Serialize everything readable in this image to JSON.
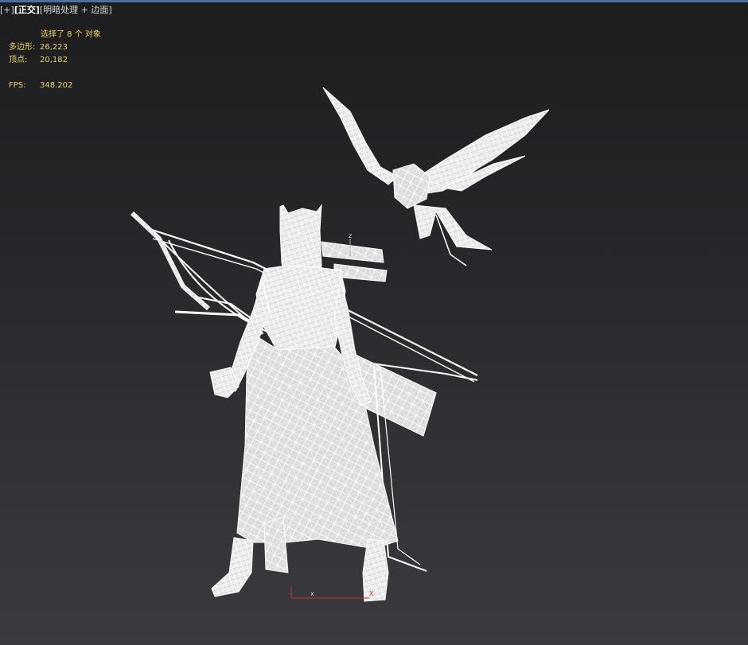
{
  "viewport": {
    "label_plus": "[+]",
    "label_view": "[正交]",
    "label_shading": "[明暗处理 + 边面]"
  },
  "stats": {
    "selection": "选择了 8 个 对象",
    "polygons_label": "多边形:",
    "polygons_value": "26,223",
    "vertices_label": "顶点:",
    "vertices_value": "20,182",
    "fps_label": "FPS:",
    "fps_value": "348.202"
  },
  "gizmo": {
    "axis_z": "z",
    "axis_x": "x",
    "axis_x_end": "X"
  },
  "colors": {
    "stats_text": "#e8d170",
    "wire": "#ffffff",
    "axis_x": "#d03030",
    "axis_y": "#c04040"
  }
}
